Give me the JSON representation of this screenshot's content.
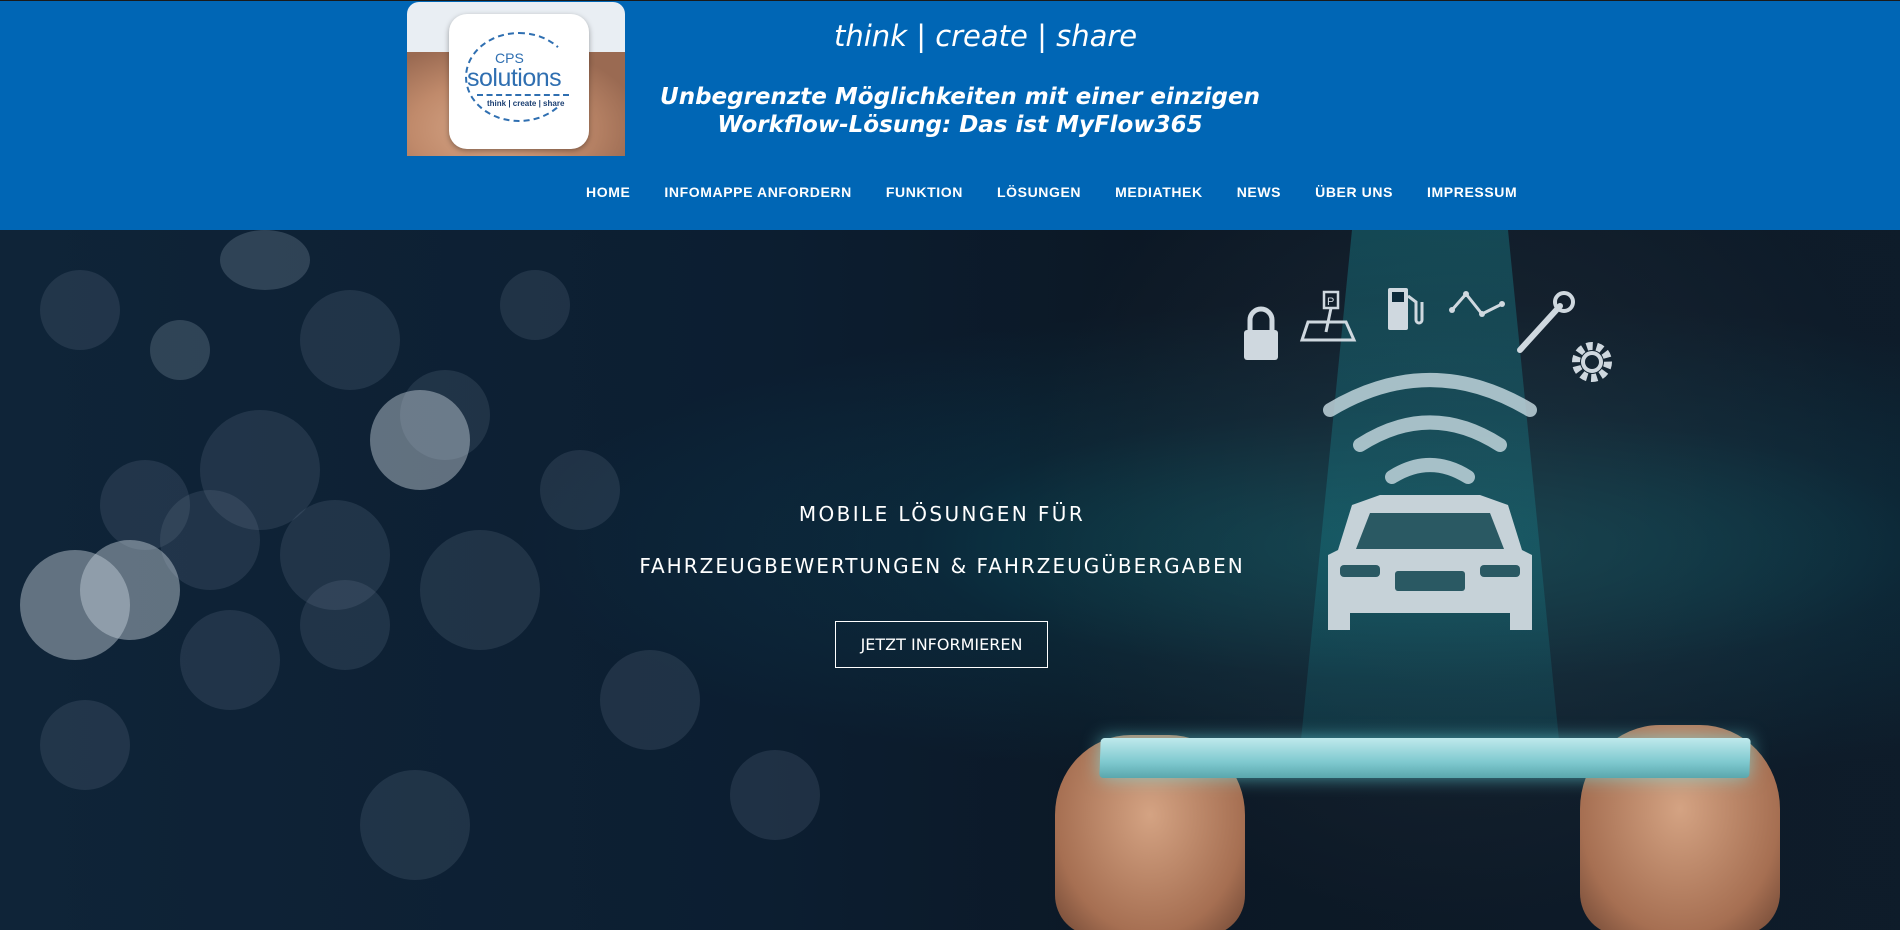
{
  "header": {
    "logo": {
      "alt": "CPS solutions logo",
      "top_text": "CPS",
      "main_text": "solutions",
      "tagline": "think | create | share"
    },
    "tagline": "think | create | share",
    "subtitle_line1": "Unbegrenzte Möglichkeiten mit einer einzigen",
    "subtitle_line2": "Workflow-Lösung: Das ist MyFlow365",
    "background_color": "#0066b5"
  },
  "nav": {
    "items": [
      {
        "label": "HOME"
      },
      {
        "label": "INFOMAPPE ANFORDERN"
      },
      {
        "label": "FUNKTION"
      },
      {
        "label": "LÖSUNGEN"
      },
      {
        "label": "MEDIATHEK"
      },
      {
        "label": "NEWS"
      },
      {
        "label": "ÜBER UNS"
      },
      {
        "label": "IMPRESSUM"
      }
    ]
  },
  "hero": {
    "heading_line1": "MOBILE LÖSUNGEN FÜR",
    "heading_line2": "FAHRZEUGBEWERTUNGEN & FAHRZEUGÜBERGABEN",
    "cta_label": "JETZT INFORMIEREN",
    "icons": [
      "lock-icon",
      "parking-icon",
      "fuel-icon",
      "graph-icon",
      "wrench-icon",
      "gear-icon",
      "wifi-icon",
      "car-icon"
    ]
  }
}
